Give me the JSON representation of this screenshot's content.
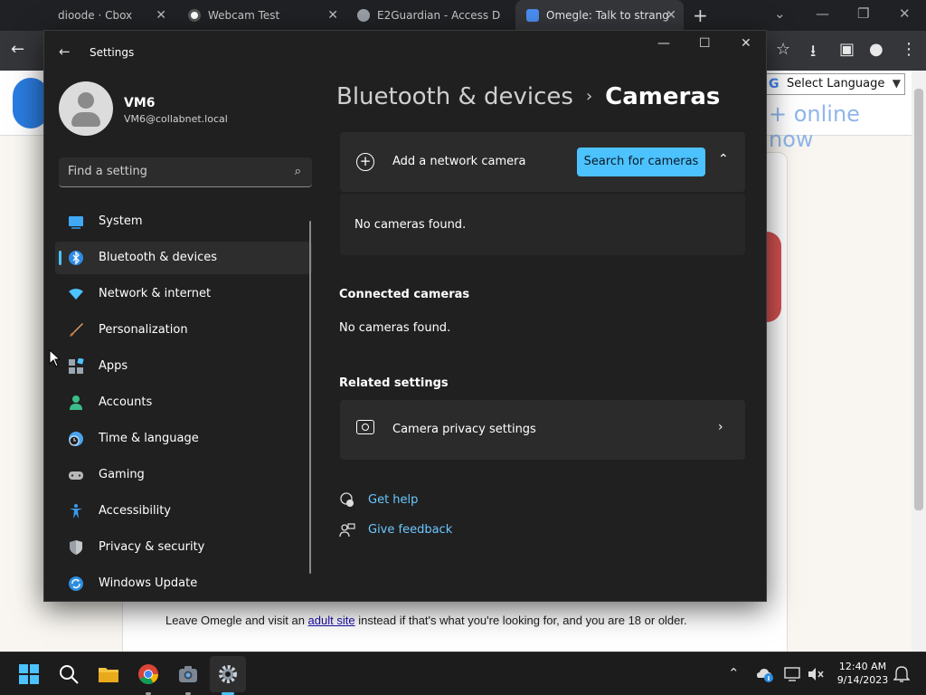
{
  "browser": {
    "tabs": [
      {
        "title": "dioode · Cbox",
        "active": false
      },
      {
        "title": "Webcam Test",
        "active": false
      },
      {
        "title": "E2Guardian - Access D",
        "active": false
      },
      {
        "title": "Omegle: Talk to strang",
        "active": true
      }
    ],
    "close_glyph": "✕",
    "new_tab_glyph": "+",
    "window_controls": {
      "chevron": "⌄",
      "minimize": "—",
      "restore": "❐",
      "close": "✕"
    },
    "toolbar": {
      "back": "←",
      "star": "☆",
      "download": "⭳",
      "sidepanel": "▣",
      "profile": "●",
      "menu": "⋮"
    }
  },
  "page": {
    "language_select": "Select Language",
    "language_g": "G",
    "language_arrow": "▼",
    "online_text": "+ online now",
    "footer_text_before": "Leave Omegle and visit an ",
    "footer_link": "adult site",
    "footer_text_after": " instead if that's what you're looking for, and you are 18 or older."
  },
  "settings": {
    "window_title": "Settings",
    "back_glyph": "←",
    "controls": {
      "minimize": "—",
      "maximize": "☐",
      "close": "✕"
    },
    "user": {
      "name": "VM6",
      "email": "VM6@collabnet.local"
    },
    "search_placeholder": "Find a setting",
    "search_glyph": "⌕",
    "nav": [
      {
        "label": "System",
        "icon": "system-icon",
        "color": "#3fa9f5"
      },
      {
        "label": "Bluetooth & devices",
        "icon": "bluetooth-icon",
        "color": "#2f8be6"
      },
      {
        "label": "Network & internet",
        "icon": "network-icon",
        "color": "#4cc2ff"
      },
      {
        "label": "Personalization",
        "icon": "brush-icon",
        "color": "#e0a26a"
      },
      {
        "label": "Apps",
        "icon": "apps-icon",
        "color": "#9aa7b3"
      },
      {
        "label": "Accounts",
        "icon": "accounts-icon",
        "color": "#3bbd8a"
      },
      {
        "label": "Time & language",
        "icon": "time-language-icon",
        "color": "#4aa3ef"
      },
      {
        "label": "Gaming",
        "icon": "gaming-icon",
        "color": "#b8b8b8"
      },
      {
        "label": "Accessibility",
        "icon": "accessibility-icon",
        "color": "#3a9ae8"
      },
      {
        "label": "Privacy & security",
        "icon": "shield-icon",
        "color": "#9aa0a6"
      },
      {
        "label": "Windows Update",
        "icon": "windows-update-icon",
        "color": "#2d8ee0"
      }
    ],
    "selected_nav_index": 1,
    "breadcrumb": {
      "parent": "Bluetooth & devices",
      "separator": "›",
      "current": "Cameras"
    },
    "add_camera": {
      "label": "Add a network camera",
      "button": "Search for cameras",
      "chevron": "⌃",
      "empty": "No cameras found."
    },
    "connected": {
      "heading": "Connected cameras",
      "empty": "No cameras found."
    },
    "related": {
      "heading": "Related settings",
      "item": "Camera privacy settings",
      "chevron": "›"
    },
    "help": {
      "get_help": "Get help",
      "feedback": "Give feedback"
    }
  },
  "taskbar": {
    "time": "12:40 AM",
    "date": "9/14/2023",
    "tray_chevron": "⌃",
    "bell": "🔔"
  }
}
